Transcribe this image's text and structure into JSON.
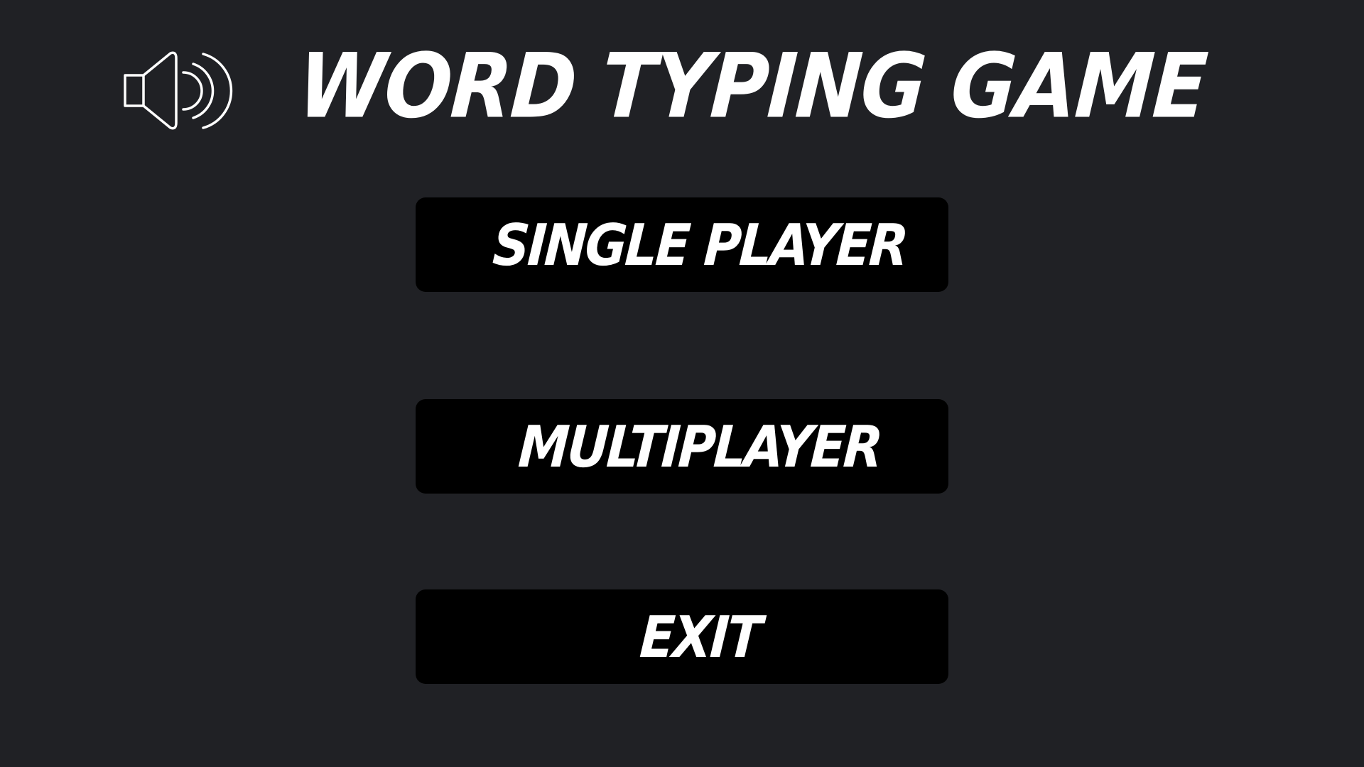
{
  "game": {
    "title": "WORD TYPING GAME"
  },
  "menu": {
    "single_player_label": "SINGLE PLAYER",
    "multiplayer_label": "MULTIPLAYER",
    "exit_label": "EXIT"
  },
  "sound": {
    "icon": "speaker-on-icon"
  },
  "colors": {
    "background": "#202125",
    "button": "#000000",
    "text": "#ffffff"
  }
}
